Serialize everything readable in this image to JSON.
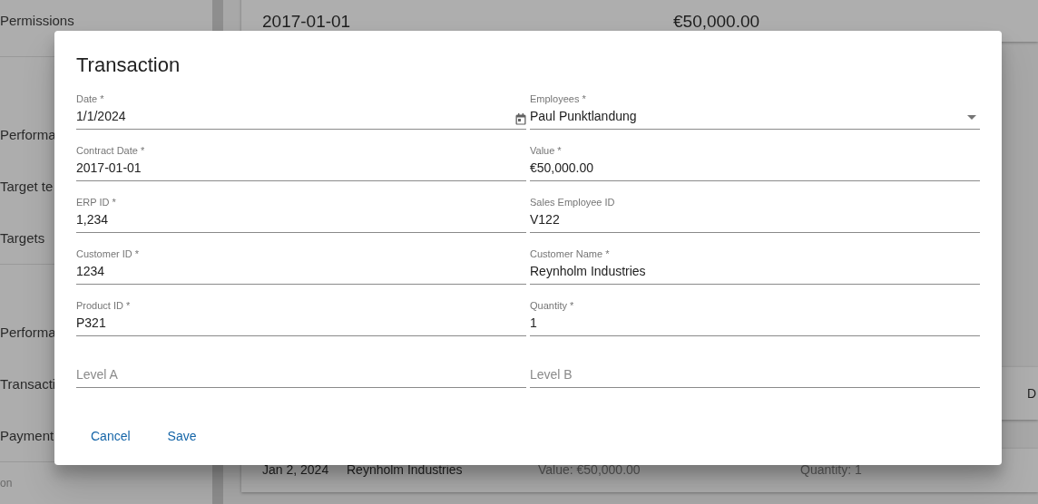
{
  "sidebar": {
    "groups": [
      {
        "items": [
          {
            "label": "Permissions"
          }
        ]
      },
      {
        "items": [
          {
            "label": "Performa"
          },
          {
            "label": "Target te"
          },
          {
            "label": "Targets"
          }
        ]
      },
      {
        "items": [
          {
            "label": "Performa"
          },
          {
            "label": "Transacti"
          },
          {
            "label": "Payment"
          }
        ]
      }
    ],
    "footer": "on"
  },
  "background": {
    "top_card": [
      "2017-01-01",
      "€50,000.00"
    ],
    "side_card": "D",
    "bottom_card": [
      "Jan 2, 2024",
      "Reynholm Industries",
      "Value: €50,000.00",
      "Quantity: 1"
    ]
  },
  "dialog": {
    "title": "Transaction",
    "fields": [
      {
        "kind": "date",
        "label": "Date *",
        "value": "1/1/2024"
      },
      {
        "kind": "select",
        "label": "Employees *",
        "value": "Paul Punktlandung"
      },
      {
        "kind": "text",
        "label": "Contract Date *",
        "value": "2017-01-01"
      },
      {
        "kind": "text",
        "label": "Value *",
        "value": "€50,000.00"
      },
      {
        "kind": "text",
        "label": "ERP ID *",
        "value": "1,234"
      },
      {
        "kind": "text",
        "label": "Sales Employee ID",
        "value": "V122"
      },
      {
        "kind": "text",
        "label": "Customer ID *",
        "value": "1234"
      },
      {
        "kind": "text",
        "label": "Customer Name *",
        "value": "Reynholm Industries"
      },
      {
        "kind": "text",
        "label": "Product ID *",
        "value": "P321"
      },
      {
        "kind": "text",
        "label": "Quantity *",
        "value": "1"
      },
      {
        "kind": "text",
        "placeholder": "Level A"
      },
      {
        "kind": "text",
        "placeholder": "Level B"
      }
    ],
    "buttons": [
      "Cancel",
      "Save"
    ]
  }
}
